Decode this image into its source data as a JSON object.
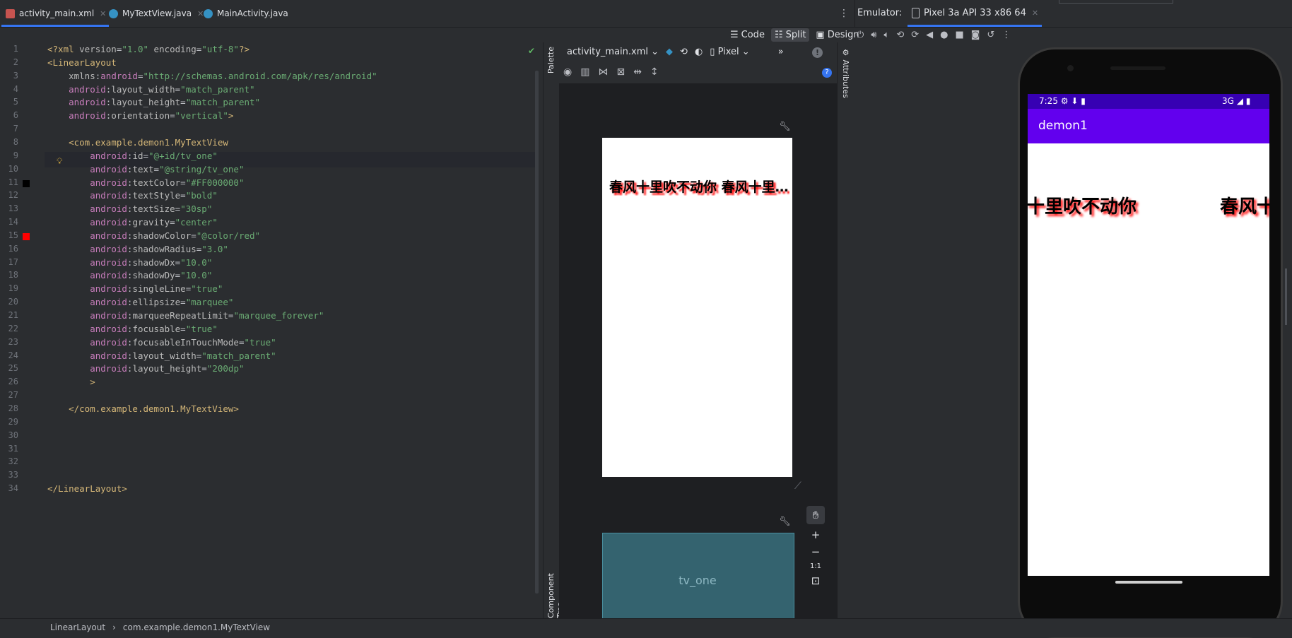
{
  "tabs": [
    {
      "label": "activity_main.xml",
      "type": "xml",
      "active": true
    },
    {
      "label": "MyTextView.java",
      "type": "java",
      "active": false
    },
    {
      "label": "MainActivity.java",
      "type": "java",
      "active": false
    }
  ],
  "emulator": {
    "label": "Emulator:",
    "device_tab": "Pixel 3a API 33 x86 64",
    "time": "7:25",
    "network": "3G",
    "app_title": "demon1",
    "marquee_text_a": "十里吹不动你",
    "marquee_text_b": "春风十"
  },
  "view_modes": {
    "code": "Code",
    "split": "Split",
    "design": "Design",
    "selected": "Split"
  },
  "design": {
    "file_dropdown": "activity_main.xml",
    "device_dropdown": "Pixel",
    "preview_text": "春风十里吹不动你 春风十里...",
    "component_label": "tv_one",
    "zoom_fit_label": "1:1"
  },
  "side_panels": {
    "palette": "Palette",
    "component_tree": "Component Tree",
    "attributes": "Attributes"
  },
  "code_lines": [
    {
      "n": "1",
      "parts": [
        [
          "t-tag",
          "<?xml "
        ],
        [
          "t-attr",
          "version"
        ],
        [
          "t-pl",
          "="
        ],
        [
          "t-val",
          "\"1.0\""
        ],
        [
          "t-attr",
          " encoding"
        ],
        [
          "t-pl",
          "="
        ],
        [
          "t-val",
          "\"utf-8\""
        ],
        [
          "t-tag",
          "?>"
        ]
      ]
    },
    {
      "n": "2",
      "parts": [
        [
          "t-tag",
          "<LinearLayout"
        ]
      ]
    },
    {
      "n": "3",
      "parts": [
        [
          "t-pl",
          "    "
        ],
        [
          "t-attr",
          "xmlns"
        ],
        [
          "t-pl",
          ":"
        ],
        [
          "t-ns",
          "android"
        ],
        [
          "t-pl",
          "="
        ],
        [
          "t-val",
          "\"http://schemas.android.com/apk/res/android\""
        ]
      ]
    },
    {
      "n": "4",
      "parts": [
        [
          "t-pl",
          "    "
        ],
        [
          "t-ns",
          "android"
        ],
        [
          "t-pl",
          ":"
        ],
        [
          "t-attr",
          "layout_width"
        ],
        [
          "t-pl",
          "="
        ],
        [
          "t-val",
          "\"match_parent\""
        ]
      ]
    },
    {
      "n": "5",
      "parts": [
        [
          "t-pl",
          "    "
        ],
        [
          "t-ns",
          "android"
        ],
        [
          "t-pl",
          ":"
        ],
        [
          "t-attr",
          "layout_height"
        ],
        [
          "t-pl",
          "="
        ],
        [
          "t-val",
          "\"match_parent\""
        ]
      ]
    },
    {
      "n": "6",
      "parts": [
        [
          "t-pl",
          "    "
        ],
        [
          "t-ns",
          "android"
        ],
        [
          "t-pl",
          ":"
        ],
        [
          "t-attr",
          "orientation"
        ],
        [
          "t-pl",
          "="
        ],
        [
          "t-val",
          "\"vertical\""
        ],
        [
          "t-tag",
          ">"
        ]
      ]
    },
    {
      "n": "7",
      "parts": []
    },
    {
      "n": "8",
      "parts": [
        [
          "t-pl",
          "    "
        ],
        [
          "t-tag",
          "<com.example.demon1.MyTextView"
        ]
      ]
    },
    {
      "n": "9",
      "parts": [
        [
          "t-pl",
          "        "
        ],
        [
          "t-ns",
          "android"
        ],
        [
          "t-pl",
          ":"
        ],
        [
          "t-attr",
          "id"
        ],
        [
          "t-pl",
          "="
        ],
        [
          "t-val",
          "\"@+id/tv_one\""
        ]
      ]
    },
    {
      "n": "10",
      "parts": [
        [
          "t-pl",
          "        "
        ],
        [
          "t-ns",
          "android"
        ],
        [
          "t-pl",
          ":"
        ],
        [
          "t-attr",
          "text"
        ],
        [
          "t-pl",
          "="
        ],
        [
          "t-val",
          "\"@string/tv_one\""
        ]
      ]
    },
    {
      "n": "11",
      "parts": [
        [
          "t-pl",
          "        "
        ],
        [
          "t-ns",
          "android"
        ],
        [
          "t-pl",
          ":"
        ],
        [
          "t-attr",
          "textColor"
        ],
        [
          "t-pl",
          "="
        ],
        [
          "t-val",
          "\"#FF000000\""
        ]
      ]
    },
    {
      "n": "12",
      "parts": [
        [
          "t-pl",
          "        "
        ],
        [
          "t-ns",
          "android"
        ],
        [
          "t-pl",
          ":"
        ],
        [
          "t-attr",
          "textStyle"
        ],
        [
          "t-pl",
          "="
        ],
        [
          "t-val",
          "\"bold\""
        ]
      ]
    },
    {
      "n": "13",
      "parts": [
        [
          "t-pl",
          "        "
        ],
        [
          "t-ns",
          "android"
        ],
        [
          "t-pl",
          ":"
        ],
        [
          "t-attr",
          "textSize"
        ],
        [
          "t-pl",
          "="
        ],
        [
          "t-val",
          "\"30sp\""
        ]
      ]
    },
    {
      "n": "14",
      "parts": [
        [
          "t-pl",
          "        "
        ],
        [
          "t-ns",
          "android"
        ],
        [
          "t-pl",
          ":"
        ],
        [
          "t-attr",
          "gravity"
        ],
        [
          "t-pl",
          "="
        ],
        [
          "t-val",
          "\"center\""
        ]
      ]
    },
    {
      "n": "15",
      "parts": [
        [
          "t-pl",
          "        "
        ],
        [
          "t-ns",
          "android"
        ],
        [
          "t-pl",
          ":"
        ],
        [
          "t-attr",
          "shadowColor"
        ],
        [
          "t-pl",
          "="
        ],
        [
          "t-val",
          "\"@color/red\""
        ]
      ]
    },
    {
      "n": "16",
      "parts": [
        [
          "t-pl",
          "        "
        ],
        [
          "t-ns",
          "android"
        ],
        [
          "t-pl",
          ":"
        ],
        [
          "t-attr",
          "shadowRadius"
        ],
        [
          "t-pl",
          "="
        ],
        [
          "t-val",
          "\"3.0\""
        ]
      ]
    },
    {
      "n": "17",
      "parts": [
        [
          "t-pl",
          "        "
        ],
        [
          "t-ns",
          "android"
        ],
        [
          "t-pl",
          ":"
        ],
        [
          "t-attr",
          "shadowDx"
        ],
        [
          "t-pl",
          "="
        ],
        [
          "t-val",
          "\"10.0\""
        ]
      ]
    },
    {
      "n": "18",
      "parts": [
        [
          "t-pl",
          "        "
        ],
        [
          "t-ns",
          "android"
        ],
        [
          "t-pl",
          ":"
        ],
        [
          "t-attr",
          "shadowDy"
        ],
        [
          "t-pl",
          "="
        ],
        [
          "t-val",
          "\"10.0\""
        ]
      ]
    },
    {
      "n": "19",
      "parts": [
        [
          "t-pl",
          "        "
        ],
        [
          "t-ns",
          "android"
        ],
        [
          "t-pl",
          ":"
        ],
        [
          "t-attr",
          "singleLine"
        ],
        [
          "t-pl",
          "="
        ],
        [
          "t-val",
          "\"true\""
        ]
      ]
    },
    {
      "n": "20",
      "parts": [
        [
          "t-pl",
          "        "
        ],
        [
          "t-ns",
          "android"
        ],
        [
          "t-pl",
          ":"
        ],
        [
          "t-attr",
          "ellipsize"
        ],
        [
          "t-pl",
          "="
        ],
        [
          "t-val",
          "\"marquee\""
        ]
      ]
    },
    {
      "n": "21",
      "parts": [
        [
          "t-pl",
          "        "
        ],
        [
          "t-ns",
          "android"
        ],
        [
          "t-pl",
          ":"
        ],
        [
          "t-attr",
          "marqueeRepeatLimit"
        ],
        [
          "t-pl",
          "="
        ],
        [
          "t-val",
          "\"marquee_forever\""
        ]
      ]
    },
    {
      "n": "22",
      "parts": [
        [
          "t-pl",
          "        "
        ],
        [
          "t-ns",
          "android"
        ],
        [
          "t-pl",
          ":"
        ],
        [
          "t-attr",
          "focusable"
        ],
        [
          "t-pl",
          "="
        ],
        [
          "t-val",
          "\"true\""
        ]
      ]
    },
    {
      "n": "23",
      "parts": [
        [
          "t-pl",
          "        "
        ],
        [
          "t-ns",
          "android"
        ],
        [
          "t-pl",
          ":"
        ],
        [
          "t-attr",
          "focusableInTouchMode"
        ],
        [
          "t-pl",
          "="
        ],
        [
          "t-val",
          "\"true\""
        ]
      ]
    },
    {
      "n": "24",
      "parts": [
        [
          "t-pl",
          "        "
        ],
        [
          "t-ns",
          "android"
        ],
        [
          "t-pl",
          ":"
        ],
        [
          "t-attr",
          "layout_width"
        ],
        [
          "t-pl",
          "="
        ],
        [
          "t-val",
          "\"match_parent\""
        ]
      ]
    },
    {
      "n": "25",
      "parts": [
        [
          "t-pl",
          "        "
        ],
        [
          "t-ns",
          "android"
        ],
        [
          "t-pl",
          ":"
        ],
        [
          "t-attr",
          "layout_height"
        ],
        [
          "t-pl",
          "="
        ],
        [
          "t-val",
          "\"200dp\""
        ]
      ]
    },
    {
      "n": "26",
      "parts": [
        [
          "t-pl",
          "        "
        ],
        [
          "t-tag",
          ">"
        ]
      ]
    },
    {
      "n": "27",
      "parts": []
    },
    {
      "n": "28",
      "parts": [
        [
          "t-pl",
          "    "
        ],
        [
          "t-tag",
          "</com.example.demon1.MyTextView>"
        ]
      ]
    },
    {
      "n": "29",
      "parts": []
    },
    {
      "n": "30",
      "parts": []
    },
    {
      "n": "31",
      "parts": []
    },
    {
      "n": "32",
      "parts": []
    },
    {
      "n": "33",
      "parts": []
    },
    {
      "n": "34",
      "parts": [
        [
          "t-tag",
          "</LinearLayout>"
        ]
      ]
    }
  ],
  "gutter_swatches": [
    {
      "line": "11",
      "color": "#000000"
    },
    {
      "line": "15",
      "color": "#ff0000"
    }
  ],
  "breadcrumbs": [
    "LinearLayout",
    "com.example.demon1.MyTextView"
  ],
  "colors": {
    "accent": "#3574f0",
    "app_bar": "#6200ee",
    "status_bar": "#3700b3",
    "shadow": "#ff0000",
    "blueprint": "#34636f"
  }
}
